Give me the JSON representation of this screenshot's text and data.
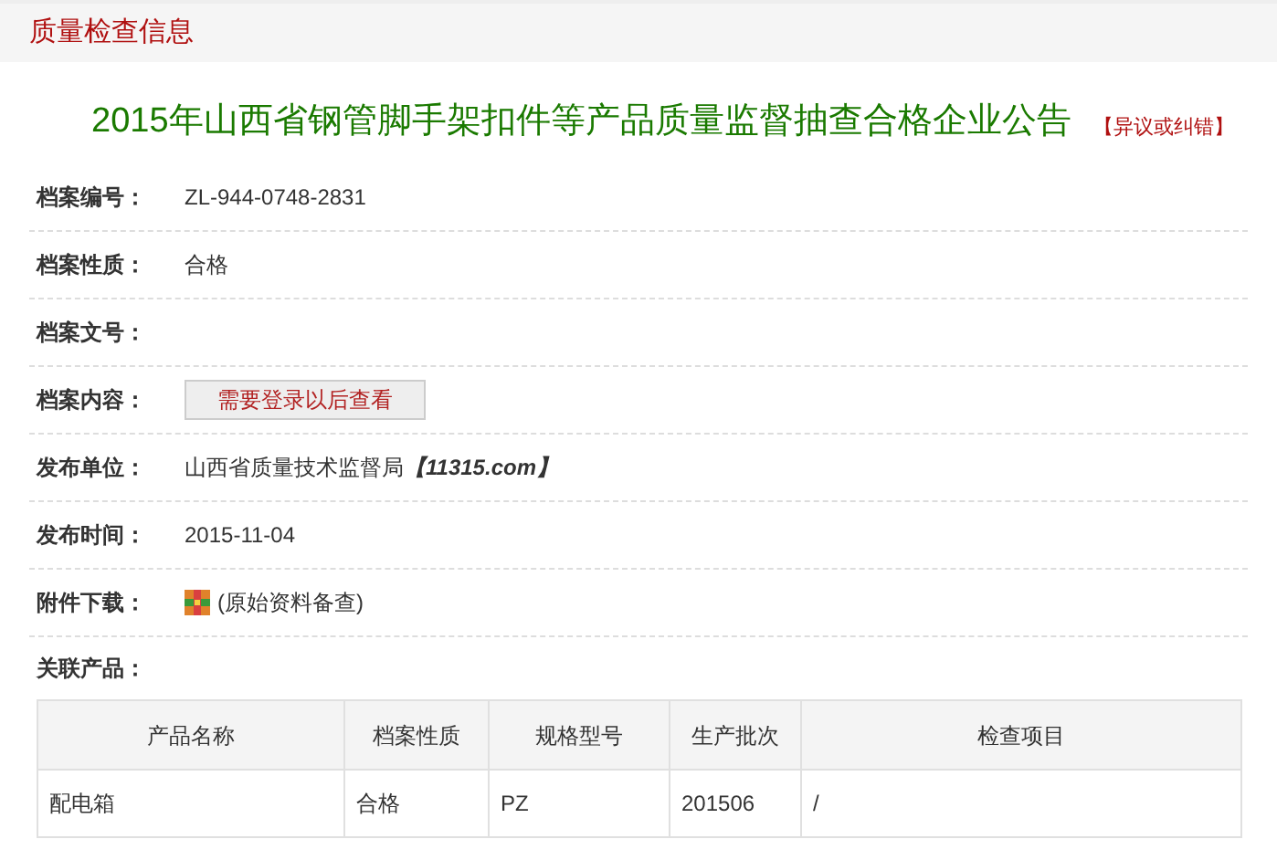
{
  "header": {
    "title": "质量检查信息"
  },
  "notice": {
    "title": "2015年山西省钢管脚手架扣件等产品质量监督抽查合格企业公告",
    "action": "【异议或纠错】"
  },
  "fields": [
    {
      "kind": "text",
      "label": "档案编号：",
      "value": "ZL-944-0748-2831"
    },
    {
      "kind": "text",
      "label": "档案性质：",
      "value": "合格"
    },
    {
      "kind": "text",
      "label": "档案文号："
    },
    {
      "kind": "button",
      "label": "档案内容：",
      "value": "需要登录以后查看"
    },
    {
      "kind": "org",
      "label": "发布单位：",
      "value": "山西省质量技术监督局",
      "site": "【11315.com】"
    },
    {
      "kind": "text",
      "label": "发布时间：",
      "value": "2015-11-04"
    },
    {
      "kind": "attachment",
      "label": "附件下载：",
      "value": "(原始资料备查)"
    }
  ],
  "products": {
    "label": "关联产品：",
    "columns": [
      "产品名称",
      "档案性质",
      "规格型号",
      "生产批次",
      "检查项目"
    ],
    "rows": [
      [
        "配电箱",
        "合格",
        "PZ",
        "201506",
        "/"
      ]
    ]
  }
}
